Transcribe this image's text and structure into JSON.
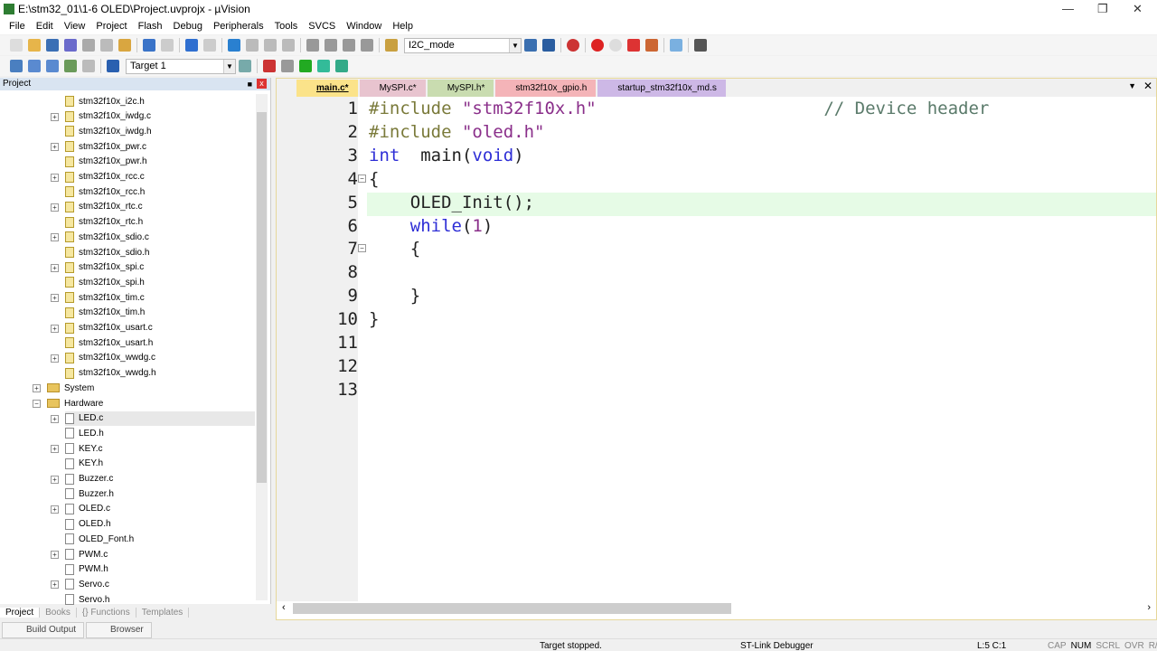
{
  "window": {
    "title": "E:\\stm32_01\\1-6 OLED\\Project.uvprojx - µVision"
  },
  "menu": [
    "File",
    "Edit",
    "View",
    "Project",
    "Flash",
    "Debug",
    "Peripherals",
    "Tools",
    "SVCS",
    "Window",
    "Help"
  ],
  "toolbar": {
    "find_combo": "I2C_mode",
    "target_combo": "Target 1"
  },
  "project_panel": {
    "title": "Project",
    "items": [
      {
        "label": "stm32f10x_i2c.h",
        "level": 2,
        "expand": false,
        "key": true
      },
      {
        "label": "stm32f10x_iwdg.c",
        "level": 2,
        "expand": true,
        "key": true
      },
      {
        "label": "stm32f10x_iwdg.h",
        "level": 2,
        "expand": false,
        "key": true
      },
      {
        "label": "stm32f10x_pwr.c",
        "level": 2,
        "expand": true,
        "key": true
      },
      {
        "label": "stm32f10x_pwr.h",
        "level": 2,
        "expand": false,
        "key": true
      },
      {
        "label": "stm32f10x_rcc.c",
        "level": 2,
        "expand": true,
        "key": true
      },
      {
        "label": "stm32f10x_rcc.h",
        "level": 2,
        "expand": false,
        "key": true
      },
      {
        "label": "stm32f10x_rtc.c",
        "level": 2,
        "expand": true,
        "key": true
      },
      {
        "label": "stm32f10x_rtc.h",
        "level": 2,
        "expand": false,
        "key": true
      },
      {
        "label": "stm32f10x_sdio.c",
        "level": 2,
        "expand": true,
        "key": true
      },
      {
        "label": "stm32f10x_sdio.h",
        "level": 2,
        "expand": false,
        "key": true
      },
      {
        "label": "stm32f10x_spi.c",
        "level": 2,
        "expand": true,
        "key": true
      },
      {
        "label": "stm32f10x_spi.h",
        "level": 2,
        "expand": false,
        "key": true
      },
      {
        "label": "stm32f10x_tim.c",
        "level": 2,
        "expand": true,
        "key": true
      },
      {
        "label": "stm32f10x_tim.h",
        "level": 2,
        "expand": false,
        "key": true
      },
      {
        "label": "stm32f10x_usart.c",
        "level": 2,
        "expand": true,
        "key": true
      },
      {
        "label": "stm32f10x_usart.h",
        "level": 2,
        "expand": false,
        "key": true
      },
      {
        "label": "stm32f10x_wwdg.c",
        "level": 2,
        "expand": true,
        "key": true
      },
      {
        "label": "stm32f10x_wwdg.h",
        "level": 2,
        "expand": false,
        "key": true
      },
      {
        "label": "System",
        "level": 1,
        "expand": true,
        "folder": true
      },
      {
        "label": "Hardware",
        "level": 1,
        "expand": "open",
        "folder": true
      },
      {
        "label": "LED.c",
        "level": 2,
        "expand": true,
        "selected": true
      },
      {
        "label": "LED.h",
        "level": 2,
        "expand": false
      },
      {
        "label": "KEY.c",
        "level": 2,
        "expand": true
      },
      {
        "label": "KEY.h",
        "level": 2,
        "expand": false
      },
      {
        "label": "Buzzer.c",
        "level": 2,
        "expand": true
      },
      {
        "label": "Buzzer.h",
        "level": 2,
        "expand": false
      },
      {
        "label": "OLED.c",
        "level": 2,
        "expand": true
      },
      {
        "label": "OLED.h",
        "level": 2,
        "expand": false
      },
      {
        "label": "OLED_Font.h",
        "level": 2,
        "expand": false
      },
      {
        "label": "PWM.c",
        "level": 2,
        "expand": true
      },
      {
        "label": "PWM.h",
        "level": 2,
        "expand": false
      },
      {
        "label": "Servo.c",
        "level": 2,
        "expand": true
      },
      {
        "label": "Servo.h",
        "level": 2,
        "expand": false
      }
    ],
    "tabs": [
      "Project",
      "Books",
      "{} Functions",
      "Templates"
    ]
  },
  "bottom_tabs": [
    "Build Output",
    "Browser"
  ],
  "editor": {
    "tabs": [
      {
        "label": "main.c*",
        "color": "#fbe38a",
        "active": true
      },
      {
        "label": "MySPI.c*",
        "color": "#e8c4cf"
      },
      {
        "label": "MySPI.h*",
        "color": "#c9dcb0"
      },
      {
        "label": "stm32f10x_gpio.h",
        "color": "#f4b4b8"
      },
      {
        "label": "startup_stm32f10x_md.s",
        "color": "#cdb8e6"
      }
    ],
    "lines": [
      [
        [
          "pp",
          "#include "
        ],
        [
          "str",
          "\"stm32f10x.h\""
        ],
        [
          "cm",
          "                      // Device header"
        ]
      ],
      [
        [
          "pp",
          "#include "
        ],
        [
          "str",
          "\"oled.h\""
        ]
      ],
      [
        [
          "kw",
          "int"
        ],
        [
          "",
          "  main("
        ],
        [
          "kw",
          "void"
        ],
        [
          "",
          ")"
        ]
      ],
      [
        [
          "",
          "{"
        ]
      ],
      [
        [
          "",
          "    OLED_Init();"
        ]
      ],
      [
        [
          "kw",
          "    while"
        ],
        [
          "",
          "("
        ],
        [
          "str",
          "1"
        ],
        [
          "",
          ")"
        ]
      ],
      [
        [
          "",
          "    {"
        ]
      ],
      [
        [
          "",
          ""
        ]
      ],
      [
        [
          "",
          "    }"
        ]
      ],
      [
        [
          "",
          "}"
        ]
      ],
      [
        [
          "",
          ""
        ]
      ],
      [
        [
          "",
          ""
        ]
      ],
      [
        [
          "",
          ""
        ]
      ]
    ]
  },
  "status": {
    "message": "Target stopped.",
    "debugger": "ST-Link Debugger",
    "position": "L:5 C:1",
    "flags": [
      "CAP",
      "NUM",
      "SCRL",
      "OVR",
      "R/W"
    ]
  }
}
